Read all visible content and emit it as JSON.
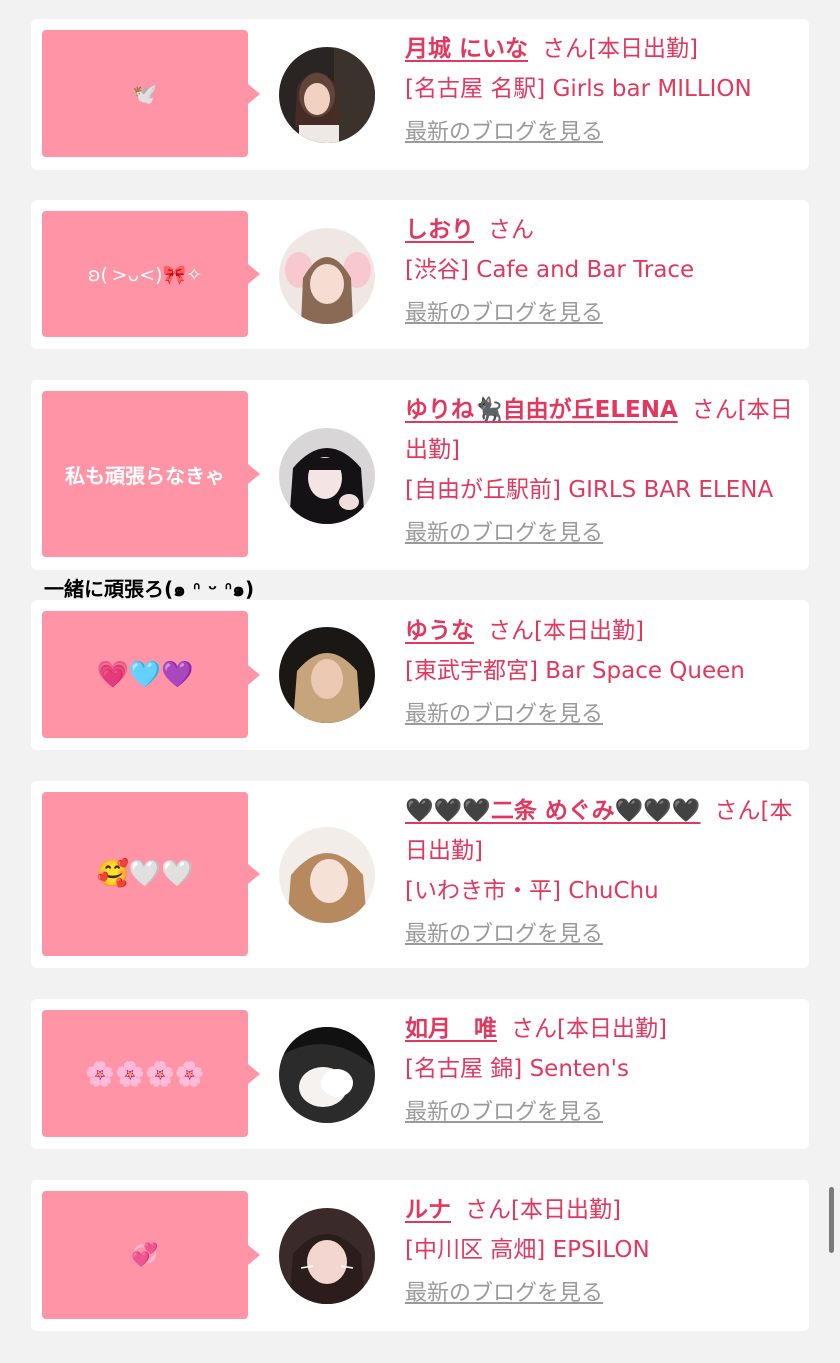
{
  "entries": [
    {
      "bubble": "🕊️",
      "name": "月城 にいな",
      "suffix": "さん[本日出勤]",
      "shop": "[名古屋 名駅] Girls bar MILLION",
      "blog_link": "最新のブログを見る"
    },
    {
      "bubble": "ʚ( >ᴗ<)🎀✧",
      "name": "しおり",
      "suffix": "さん",
      "shop": "[渋谷] Cafe and Bar Trace",
      "blog_link": "最新のブログを見る"
    },
    {
      "bubble": "私も頑張らなきゃ",
      "overflow": "一緒に頑張ろ(๑ ᐢ ᵕ ᐢ๑)",
      "name": "ゆりね🐈‍⬛自由が丘ELENA",
      "suffix": "さん[本日出勤]",
      "shop": "[自由が丘駅前] GIRLS BAR ELENA",
      "blog_link": "最新のブログを見る"
    },
    {
      "bubble": "💗🩵💜",
      "name": "ゆうな",
      "suffix": "さん[本日出勤]",
      "shop": "[東武宇都宮] Bar Space Queen",
      "blog_link": "最新のブログを見る"
    },
    {
      "bubble": "🥰🤍🤍",
      "name": "🖤🖤🖤二条 めぐみ🖤🖤🖤",
      "suffix": "さん[本日出勤]",
      "shop": "[いわき市・平] ChuChu",
      "blog_link": "最新のブログを見る"
    },
    {
      "bubble": "🌸🌸🌸🌸",
      "name": "如月　唯",
      "suffix": "さん[本日出勤]",
      "shop": "[名古屋 錦] Senten's",
      "blog_link": "最新のブログを見る"
    },
    {
      "bubble": "💞",
      "name": "ルナ",
      "suffix": "さん[本日出勤]",
      "shop": "[中川区 高畑] EPSILON",
      "blog_link": "最新のブログを見る"
    }
  ],
  "colors": {
    "accent": "#e0385f",
    "bubble": "#ff94a6",
    "link_gray": "#9a9a9a",
    "background": "#f2f2f2"
  }
}
